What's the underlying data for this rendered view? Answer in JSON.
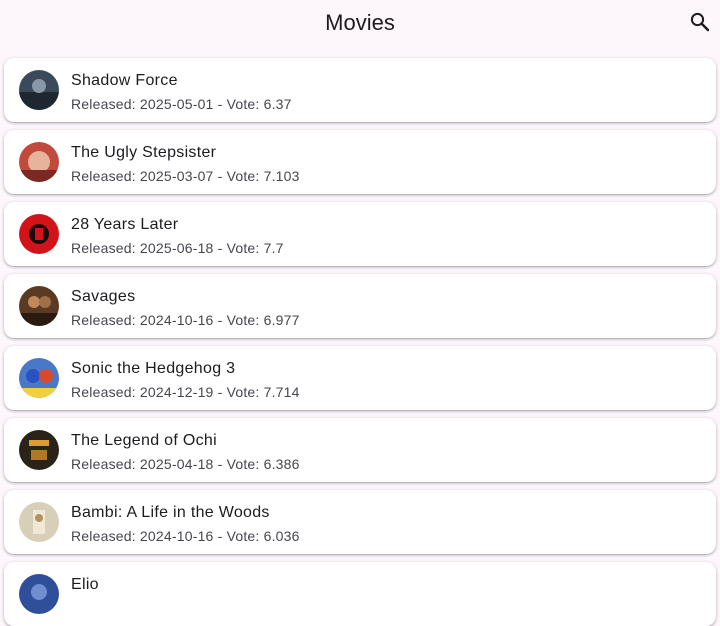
{
  "appbar": {
    "title": "Movies",
    "search_icon": "search-icon"
  },
  "movies": [
    {
      "title": "Shadow Force",
      "subtitle": "Released: 2025-05-01 - Vote: 6.37",
      "poster_color": "#3a4a5a"
    },
    {
      "title": "The Ugly Stepsister",
      "subtitle": "Released: 2025-03-07 - Vote: 7.103",
      "poster_color": "#c24a3c"
    },
    {
      "title": "28 Years Later",
      "subtitle": "Released: 2025-06-18 - Vote: 7.7",
      "poster_color": "#d2141a"
    },
    {
      "title": "Savages",
      "subtitle": "Released: 2024-10-16 - Vote: 6.977",
      "poster_color": "#5a3a22"
    },
    {
      "title": "Sonic the Hedgehog 3",
      "subtitle": "Released: 2024-12-19 - Vote: 7.714",
      "poster_color": "#4a78c8"
    },
    {
      "title": "The Legend of Ochi",
      "subtitle": "Released: 2025-04-18 - Vote: 6.386",
      "poster_color": "#2a2418"
    },
    {
      "title": "Bambi: A Life in the Woods",
      "subtitle": "Released: 2024-10-16 - Vote: 6.036",
      "poster_color": "#d8cfb8"
    },
    {
      "title": "Elio",
      "subtitle": "",
      "poster_color": "#2f4f9a"
    }
  ]
}
